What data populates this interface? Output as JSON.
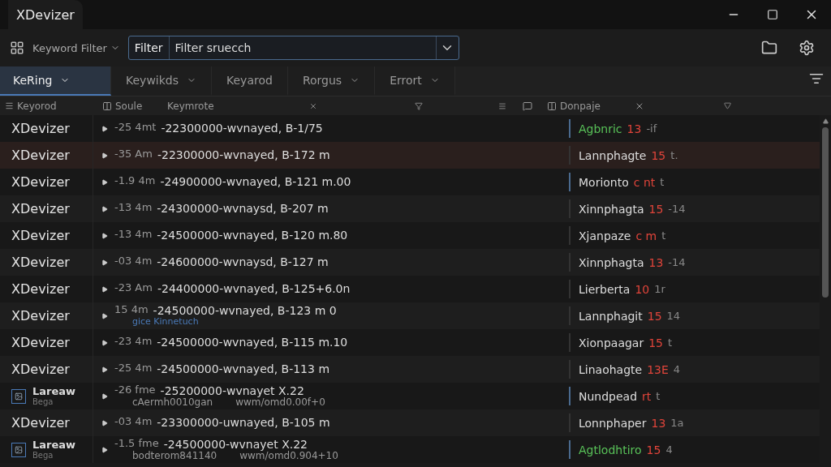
{
  "window": {
    "title": "XDevizer"
  },
  "toolbar": {
    "filter_mode": "Keyword Filter",
    "filter_label": "Filter",
    "search_value": "Filter sruecch"
  },
  "tabs": [
    {
      "label": "KeRing",
      "selected": true
    },
    {
      "label": "Keywikds",
      "selected": false
    },
    {
      "label": "Keyarod",
      "selected": false
    },
    {
      "label": "Rorgus",
      "selected": false
    },
    {
      "label": "Errort",
      "selected": false
    }
  ],
  "columns": {
    "name": "Keyorod",
    "source": "Soule",
    "detail": "Keymrote",
    "target": "Donpaje"
  },
  "rows": [
    {
      "kind": "plain",
      "name": "XDevizer",
      "selected": false,
      "offset": "-25 4mt",
      "value": "-22300000-wvnayed, B-1/75",
      "target": "Agbnric",
      "num": "13",
      "extra": "-if",
      "highlighted": true,
      "marked": true
    },
    {
      "kind": "plain",
      "name": "XDevizer",
      "selected": true,
      "offset": "-35 Am",
      "value": "-22300000-wvnayed, B-172 m",
      "target": "Lannphagte",
      "num": "15",
      "extra": "t.",
      "highlighted": false,
      "marked": false
    },
    {
      "kind": "plain",
      "name": "XDevizer",
      "selected": false,
      "offset": "-1.9 4m",
      "value": "-24900000-wvnayed, B-121 m.00",
      "target": "Morionto",
      "num": "c nt",
      "extra": "t",
      "highlighted": false,
      "marked": true
    },
    {
      "kind": "plain",
      "name": "XDevizer",
      "selected": false,
      "offset": "-13 4m",
      "value": "-24300000-wvnaysd, B-207 m",
      "target": "Xinnphagta",
      "num": "15",
      "extra": "-14",
      "highlighted": false,
      "marked": false
    },
    {
      "kind": "plain",
      "name": "XDevizer",
      "selected": false,
      "offset": "-13 4m",
      "value": "-24500000-wvnayed, B-120 m.80",
      "target": "Xjanpaze",
      "num": "c m",
      "extra": "t",
      "highlighted": false,
      "marked": false
    },
    {
      "kind": "plain",
      "name": "XDevizer",
      "selected": false,
      "offset": "-03 4m",
      "value": "-24600000-wvnaysd, B-127 m",
      "target": "Xinnphagta",
      "num": "13",
      "extra": "-14",
      "highlighted": false,
      "marked": false
    },
    {
      "kind": "plain",
      "name": "XDevizer",
      "selected": false,
      "offset": "-23 Am",
      "value": "-24400000-wvnayed, B-125+6.0n",
      "target": "Lierberta",
      "num": "10",
      "extra": "1r",
      "highlighted": false,
      "marked": false
    },
    {
      "kind": "plain",
      "name": "XDevizer",
      "selected": false,
      "offset": "15 4m",
      "value": "-24500000-wvnayed, B-123 m 0",
      "note": "gice Kinnetuch",
      "target": "Lannphagit",
      "num": "15",
      "extra": "14",
      "highlighted": false,
      "marked": false
    },
    {
      "kind": "plain",
      "name": "XDevizer",
      "selected": false,
      "offset": "-23 4m",
      "value": "-24500000-wvnayed, B-115 m.10",
      "target": "Xionpaagar",
      "num": "15",
      "extra": "t",
      "highlighted": false,
      "marked": false
    },
    {
      "kind": "plain",
      "name": "XDevizer",
      "selected": false,
      "offset": "-25 4m",
      "value": "-24500000-wvnayed, B-113 m",
      "target": "Linaohagte",
      "num": "13E",
      "extra": "4",
      "highlighted": false,
      "marked": false
    },
    {
      "kind": "item",
      "name": "Lareaw",
      "sub": "Bega",
      "selected": false,
      "offset": "-26 fme",
      "value": "-25200000-wvnayet X.22",
      "sub_left": "cAermh0010gan",
      "sub_right": "wwm/omd0.00f+0",
      "target": "Nundpead",
      "num": "rt",
      "extra": "t",
      "highlighted": false,
      "marked": true
    },
    {
      "kind": "plain",
      "name": "XDevizer",
      "selected": false,
      "offset": "-03 4m",
      "value": "-23300000-uwnayed, B-105 m",
      "target": "Lonnphaper",
      "num": "13",
      "extra": "1a",
      "highlighted": false,
      "marked": false
    },
    {
      "kind": "item",
      "name": "Lareaw",
      "sub": "Bega",
      "selected": false,
      "offset": "-1.5 fme",
      "value": "-24500000-wvnayet X.22",
      "sub_left": "bodterom841140",
      "sub_right": "wwm/omd0.904+10",
      "target": "Agtlodhtiro",
      "num": "15",
      "extra": "4",
      "highlighted": true,
      "marked": true
    }
  ]
}
